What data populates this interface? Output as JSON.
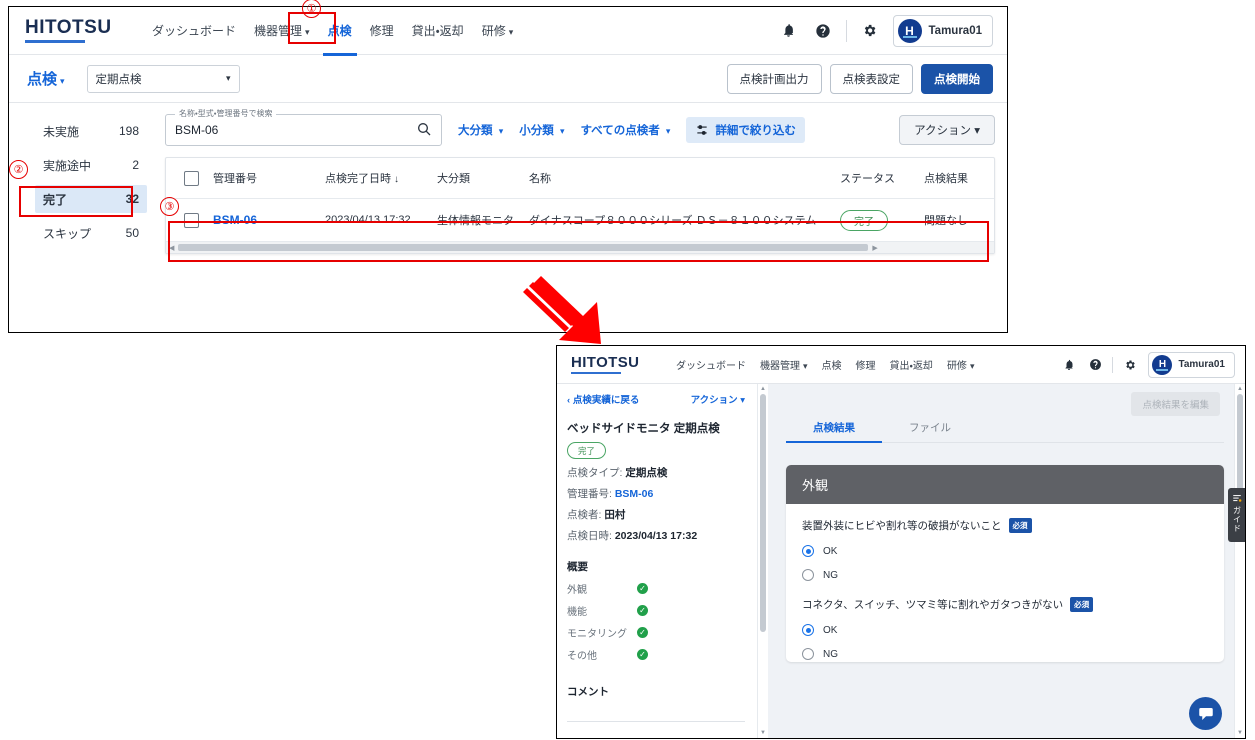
{
  "brand": {
    "name": "HITOTSU"
  },
  "window1": {
    "nav": [
      {
        "label": "ダッシュボード",
        "caret": false,
        "active": false
      },
      {
        "label": "機器管理",
        "caret": true,
        "active": false
      },
      {
        "label": "点検",
        "caret": false,
        "active": true
      },
      {
        "label": "修理",
        "caret": false,
        "active": false
      },
      {
        "label": "貸出・返却",
        "caret": false,
        "active": false
      },
      {
        "label": "研修",
        "caret": true,
        "active": false
      }
    ],
    "header_icons": [
      {
        "name": "bell-icon",
        "glyph": "🔔"
      },
      {
        "name": "help-icon",
        "glyph": "?"
      },
      {
        "name": "gear-icon",
        "glyph": "⚙"
      }
    ],
    "user": {
      "initial": "H",
      "name": "Tamura01"
    },
    "subbar": {
      "title": "点検",
      "title_caret": "▾",
      "select_value": "定期点検",
      "buttons": [
        {
          "label": "点検計画出力",
          "primary": false
        },
        {
          "label": "点検表設定",
          "primary": false
        },
        {
          "label": "点検開始",
          "primary": true
        }
      ]
    },
    "statuses": [
      {
        "label": "未実施",
        "count": "198",
        "selected": false
      },
      {
        "label": "実施途中",
        "count": "2",
        "selected": false
      },
      {
        "label": "完了",
        "count": "32",
        "selected": true
      },
      {
        "label": "スキップ",
        "count": "50",
        "selected": false
      }
    ],
    "search": {
      "floating_label": "名称・型式・管理番号で検索",
      "value": "BSM-06",
      "placeholder": "名称・型式・管理番号で検索"
    },
    "filters": [
      {
        "label": "大分類",
        "caret": "▾"
      },
      {
        "label": "小分類",
        "caret": "▾"
      },
      {
        "label": "すべての点検者",
        "caret": "▾"
      }
    ],
    "refine_label": "詳細で絞り込む",
    "action_label": "アクション ▾",
    "table": {
      "columns": [
        "管理番号",
        "点検完了日時",
        "大分類",
        "名称",
        "ステータス",
        "点検結果"
      ],
      "sort_indicator": "↓",
      "rows": [
        {
          "id": "BSM-06",
          "date": "2023/04/13 17:32",
          "category": "生体情報モニタ",
          "name": "ダイナスコープ８０００シリーズ ＤＳ－８１００システム",
          "status": "完了",
          "result": "問題なし"
        }
      ]
    }
  },
  "annotations": [
    {
      "id": "1",
      "label": "①"
    },
    {
      "id": "2",
      "label": "②"
    },
    {
      "id": "3",
      "label": "③"
    }
  ],
  "window2": {
    "nav": [
      {
        "label": "ダッシュボード",
        "caret": false,
        "active": false
      },
      {
        "label": "機器管理",
        "caret": true,
        "active": false
      },
      {
        "label": "点検",
        "caret": false,
        "active": false
      },
      {
        "label": "修理",
        "caret": false,
        "active": false
      },
      {
        "label": "貸出・返却",
        "caret": false,
        "active": false
      },
      {
        "label": "研修",
        "caret": true,
        "active": false
      }
    ],
    "user": {
      "initial": "H",
      "name": "Tamura01"
    },
    "detail": {
      "back_label": "点検実績に戻る",
      "action_label": "アクション ▾",
      "title": "ベッドサイドモニタ 定期点検",
      "status_badge": "完了",
      "fields": [
        {
          "key": "点検タイプ:",
          "value": "定期点検",
          "link": false
        },
        {
          "key": "管理番号:",
          "value": "BSM-06",
          "link": true
        },
        {
          "key": "点検者:",
          "value": "田村",
          "link": false
        },
        {
          "key": "点検日時:",
          "value": "2023/04/13 17:32",
          "link": false
        }
      ],
      "summary_heading": "概要",
      "summary": [
        {
          "label": "外観",
          "ok": true
        },
        {
          "label": "機能",
          "ok": true
        },
        {
          "label": "モニタリング",
          "ok": true
        },
        {
          "label": "その他",
          "ok": true
        }
      ],
      "comment_heading": "コメント"
    },
    "content": {
      "edit_button": "点検結果を編集",
      "tabs": [
        {
          "label": "点検結果",
          "active": true
        },
        {
          "label": "ファイル",
          "active": false
        }
      ],
      "section_title": "外観",
      "questions": [
        {
          "text": "装置外装にヒビや割れ等の破損がないこと",
          "required_badge": "必須",
          "options": [
            {
              "label": "OK",
              "selected": true
            },
            {
              "label": "NG",
              "selected": false
            }
          ]
        },
        {
          "text": "コネクタ、スイッチ、ツマミ等に割れやガタつきがない",
          "required_badge": "必須",
          "options": [
            {
              "label": "OK",
              "selected": true
            },
            {
              "label": "NG",
              "selected": false
            }
          ]
        }
      ]
    },
    "guide_tab": "ガイド"
  },
  "colors": {
    "accent_blue": "#1565d8",
    "primary_button": "#1b53a8",
    "annotation_red": "#e60000",
    "status_green": "#3b8d52",
    "section_header_gray": "#5f6166"
  }
}
